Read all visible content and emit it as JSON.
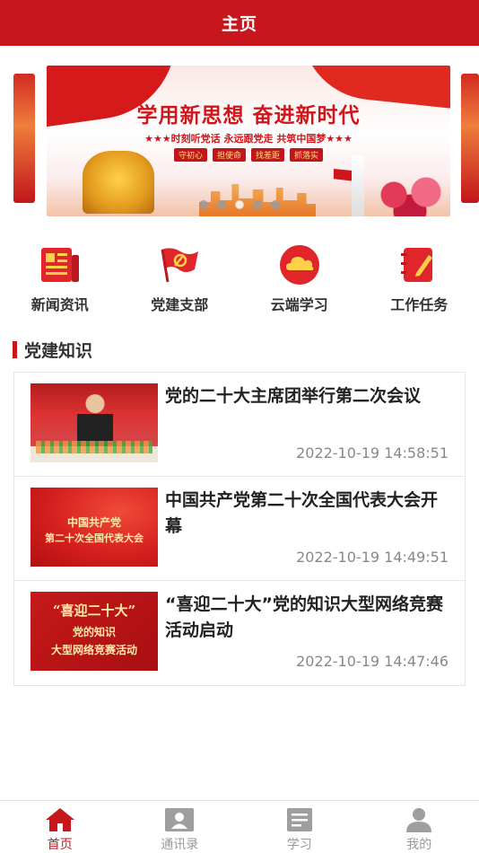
{
  "header": {
    "title": "主页"
  },
  "banner": {
    "headline": "学用新思想 奋进新时代",
    "subline": "★★★时刻听党话 永远跟党走 共筑中国梦★★★",
    "tags": [
      "守初心",
      "担使命",
      "找差距",
      "抓落实"
    ],
    "slide_count": 5,
    "active_slide": 3
  },
  "menu": [
    {
      "label": "新闻资讯",
      "icon": "newspaper-icon"
    },
    {
      "label": "党建支部",
      "icon": "party-flag-icon"
    },
    {
      "label": "云端学习",
      "icon": "cloud-icon"
    },
    {
      "label": "工作任务",
      "icon": "notebook-pen-icon"
    }
  ],
  "section": {
    "title": "党建知识"
  },
  "news": [
    {
      "title": "党的二十大主席团举行第二次会议",
      "time": "2022-10-19 14:58:51"
    },
    {
      "title": "中国共产党第二十次全国代表大会开幕",
      "time": "2022-10-19 14:49:51",
      "thumb_text": [
        "中国共产党",
        "第二十次全国代表大会"
      ]
    },
    {
      "title": "“喜迎二十大”党的知识大型网络竞赛活动启动",
      "time": "2022-10-19 14:47:46",
      "thumb_text": [
        "“喜迎二十大”",
        "党的知识",
        "大型网络竞赛活动"
      ]
    }
  ],
  "tabs": [
    {
      "label": "首页",
      "icon": "home-icon",
      "active": true
    },
    {
      "label": "通讯录",
      "icon": "contacts-icon",
      "active": false
    },
    {
      "label": "学习",
      "icon": "document-icon",
      "active": false
    },
    {
      "label": "我的",
      "icon": "user-icon",
      "active": false
    }
  ],
  "colors": {
    "primary": "#c8161d",
    "accent_yellow": "#ffd04a",
    "muted": "#999999"
  }
}
